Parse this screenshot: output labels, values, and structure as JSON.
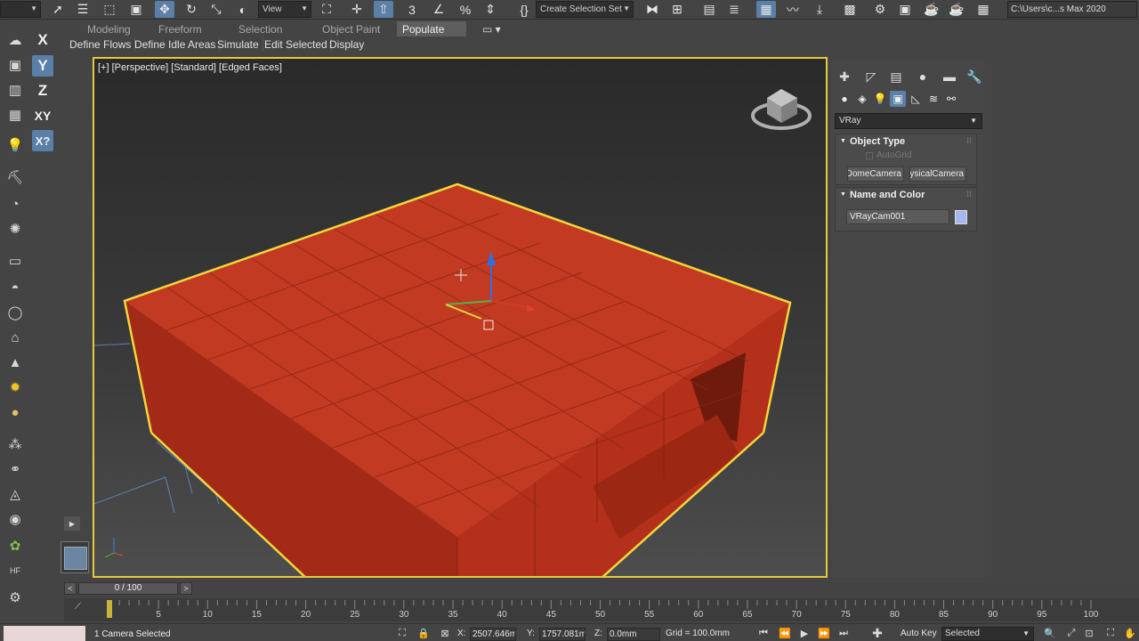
{
  "toolbar": {
    "view_dropdown": "View",
    "selection_set": "Create Selection Set",
    "path": "C:\\Users\\c...s Max 2020"
  },
  "ribbon": {
    "tabs": [
      {
        "label": "Modeling",
        "active": false
      },
      {
        "label": "Freeform",
        "active": false
      },
      {
        "label": "Selection",
        "active": false
      },
      {
        "label": "Object Paint",
        "active": false
      },
      {
        "label": "Populate",
        "active": true
      }
    ],
    "commands": [
      "Define Flows",
      "Define Idle Areas",
      "Simulate",
      "Edit Selected",
      "Display"
    ]
  },
  "axis_constraints": [
    {
      "label": "X",
      "active": false
    },
    {
      "label": "Y",
      "active": true
    },
    {
      "label": "Z",
      "active": false
    },
    {
      "label": "XY",
      "active": false
    },
    {
      "label": "X?",
      "active": true
    }
  ],
  "viewport": {
    "label": "[+] [Perspective] [Standard] [Edged Faces]",
    "highlight_color": "#e9c83c",
    "object_color": "#c23a22"
  },
  "command_panel": {
    "renderer_dropdown": "VRay",
    "object_type": {
      "title": "Object Type",
      "autogrid_label": "AutoGrid",
      "buttons": [
        "VRayDomeCamera",
        "VRayPhysicalCamera"
      ]
    },
    "name_and_color": {
      "title": "Name and Color",
      "name": "VRayCam001",
      "color": "#a6b6ef"
    }
  },
  "timeline": {
    "frame_display": "0 / 100",
    "ticks": [
      "5",
      "10",
      "15",
      "20",
      "25",
      "30",
      "35",
      "40",
      "45",
      "50",
      "55",
      "60",
      "65",
      "70",
      "75",
      "80",
      "85",
      "90",
      "95",
      "100"
    ]
  },
  "status": {
    "selection": "1 Camera Selected",
    "x_label": "X:",
    "x_value": "2507.646m",
    "y_label": "Y:",
    "y_value": "1757.081m",
    "z_label": "Z:",
    "z_value": "0.0mm",
    "grid": "Grid = 100.0mm",
    "auto_key": "Auto Key",
    "key_mode": "Selected"
  }
}
